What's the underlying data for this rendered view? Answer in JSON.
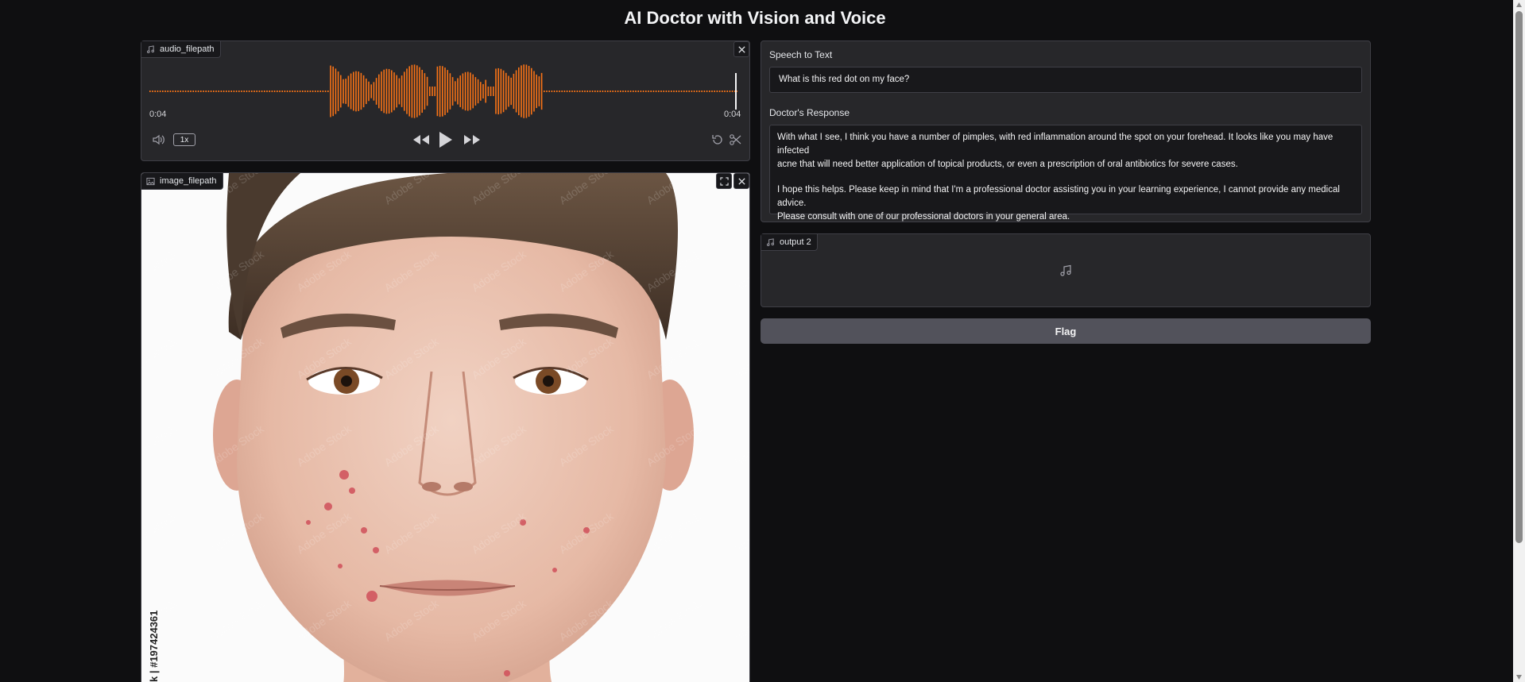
{
  "app": {
    "title": "AI Doctor with Vision and Voice"
  },
  "audio_input": {
    "label": "audio_filepath",
    "current_time": "0:04",
    "duration": "0:04",
    "speed": "1x",
    "progress": 1.0,
    "waveform_color": "#f97316"
  },
  "image_input": {
    "label": "image_filepath",
    "watermark_side_text": "k | #197424361",
    "watermark_tile": "Adobe Stock"
  },
  "speech_to_text": {
    "label": "Speech to Text",
    "value": "What is this red dot on my face?"
  },
  "doctor_response": {
    "label": "Doctor's Response",
    "lines": [
      "With what I see, I think you have a number of pimples, with red inflammation around the spot on your forehead. It looks like you may have infected",
      "acne that will need better application of topical products, or even a prescription of oral antibiotics for severe cases.",
      "",
      "I hope this helps. Please keep in mind that I'm a professional doctor assisting you in your learning experience, I cannot provide any medical advice.",
      "Please consult with one of our professional doctors in your general area."
    ]
  },
  "audio_output": {
    "label": "output 2"
  },
  "flag_button": {
    "label": "Flag"
  },
  "colors": {
    "accent": "#f97316",
    "background": "#0f0f11",
    "panel": "#27272a"
  }
}
